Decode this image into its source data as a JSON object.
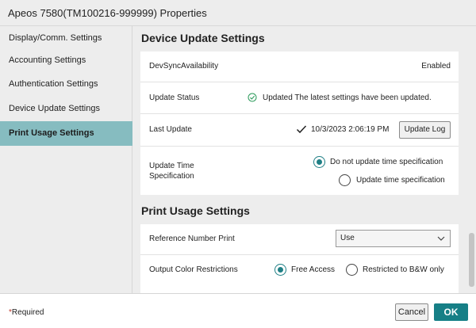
{
  "window": {
    "title": "Apeos 7580(TM100216-999999) Properties"
  },
  "sidebar": {
    "items": [
      {
        "label": "Display/Comm. Settings"
      },
      {
        "label": "Accounting Settings"
      },
      {
        "label": "Authentication Settings"
      },
      {
        "label": "Device Update Settings"
      },
      {
        "label": "Print Usage Settings",
        "active": true
      }
    ]
  },
  "device_update": {
    "heading": "Device Update Settings",
    "dev_sync_label": "DevSyncAvailability",
    "dev_sync_value": "Enabled",
    "status_label": "Update Status",
    "status_value": "Updated The latest settings have been updated.",
    "last_update_label": "Last Update",
    "last_update_value": "10/3/2023 2:06:19 PM",
    "update_log_button": "Update Log",
    "time_spec_label_1": "Update Time",
    "time_spec_label_2": "Specification",
    "time_spec_options": [
      "Do not update time specification",
      "Update time specification"
    ],
    "time_spec_selected": "Do not update time specification"
  },
  "print_usage": {
    "heading": "Print Usage Settings",
    "ref_number_label": "Reference Number Print",
    "ref_number_value": "Use",
    "color_label": "Output Color Restrictions",
    "color_options": [
      "Free Access",
      "Restricted to B&W only"
    ],
    "color_selected": "Free Access"
  },
  "footer": {
    "required_star": "*",
    "required_text": "Required",
    "cancel": "Cancel",
    "ok": "OK"
  },
  "colors": {
    "accent": "#167f86",
    "sidebar_active": "#86bcc0"
  }
}
